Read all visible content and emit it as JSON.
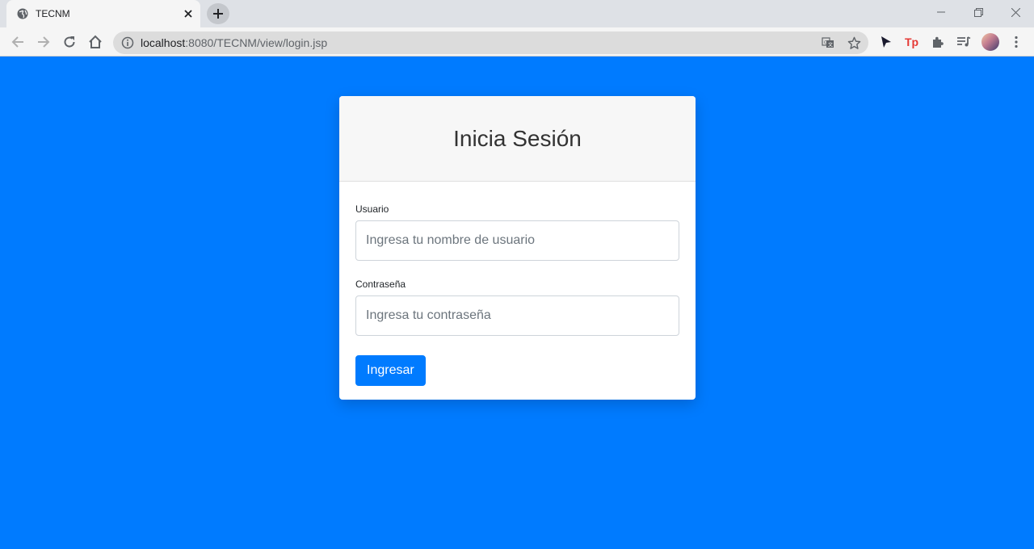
{
  "browser": {
    "tab_title": "TECNM",
    "url_host": "localhost",
    "url_path": ":8080/TECNM/view/login.jsp"
  },
  "login": {
    "title": "Inicia Sesión",
    "username_label": "Usuario",
    "username_placeholder": "Ingresa tu nombre de usuario",
    "password_label": "Contraseña",
    "password_placeholder": "Ingresa tu contraseña",
    "submit_label": "Ingresar"
  },
  "colors": {
    "page_background": "#007bff",
    "primary_button": "#007bff",
    "extension_tp": "#e53935"
  },
  "icons": {
    "tab_favicon": "globe-icon",
    "tab_close": "close-icon",
    "new_tab": "plus-icon",
    "back": "arrow-left-icon",
    "forward": "arrow-right-icon",
    "reload": "reload-icon",
    "home": "home-icon",
    "site_info": "info-icon",
    "translate": "translate-icon",
    "bookmark": "star-icon",
    "cursor_extension": "cursor-icon",
    "tp_extension": "tp-icon",
    "extensions": "puzzle-icon",
    "media_control": "playlist-icon",
    "menu": "kebab-menu-icon"
  },
  "extension_text": {
    "tp": "Tp"
  }
}
